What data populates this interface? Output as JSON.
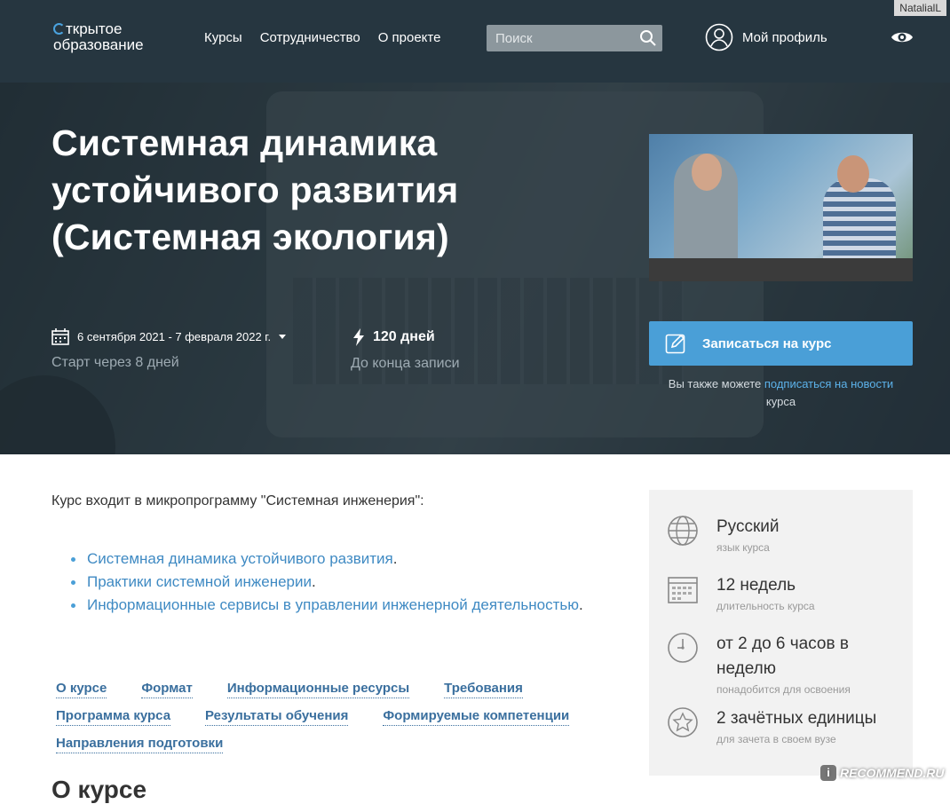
{
  "header": {
    "logo_line1": "ткрытое",
    "logo_line2": "образование",
    "nav": [
      "Курсы",
      "Сотрудничество",
      "О проекте"
    ],
    "search_placeholder": "Поиск",
    "profile_label": "Мой профиль",
    "user_badge": "NatalialL"
  },
  "hero": {
    "title": "Системная динамика устойчивого развития (Системная экология)",
    "dates": "6 сентября 2021 - 7 февраля 2022 г.",
    "dates_sub": "Старт через 8 дней",
    "enroll_days": "120 дней",
    "enroll_sub": "До конца записи",
    "enroll_button": "Записаться на курс",
    "subscribe_prefix": "Вы также можете",
    "subscribe_link": "подписаться на новости",
    "subscribe_suffix": "курса"
  },
  "main": {
    "intro": "Курс входит в микропрограмму \"Системная инженерия\":",
    "microprogram": [
      "Системная динамика устойчивого развития",
      "Практики системной инженерии",
      "Информационные сервисы в управлении инженерной деятельностью"
    ],
    "tabs": [
      "О курсе",
      "Формат",
      "Информационные ресурсы",
      "Требования",
      "Программа курса",
      "Результаты обучения",
      "Формируемые компетенции",
      "Направления подготовки"
    ],
    "section_title": "О курсе"
  },
  "facts": [
    {
      "icon": "globe-icon",
      "value": "Русский",
      "label": "язык курса"
    },
    {
      "icon": "calendar-grid-icon",
      "value": "12 недель",
      "label": "длительность курса"
    },
    {
      "icon": "clock-icon",
      "value": "от 2 до 6 часов в неделю",
      "label": "понадобится для освоения"
    },
    {
      "icon": "star-badge-icon",
      "value": "2 зачётных единицы",
      "label": "для зачета в своем вузе"
    }
  ],
  "watermark": "RECOMMEND.RU",
  "colors": {
    "header_bg": "#263640",
    "accent": "#4a9fd7",
    "link": "#3f8ac3"
  }
}
